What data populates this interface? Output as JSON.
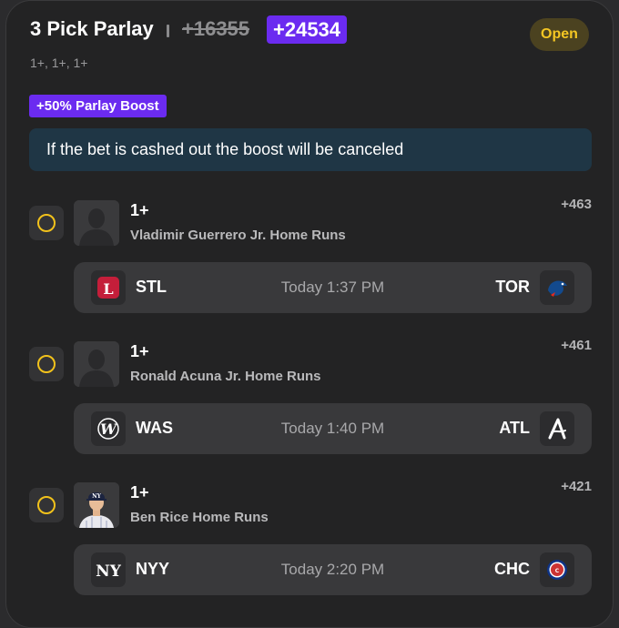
{
  "header": {
    "title": "3 Pick Parlay",
    "original_odds": "+16355",
    "boosted_odds": "+24534",
    "status": "Open",
    "subtitle": "1+, 1+, 1+"
  },
  "boost": {
    "badge": "+50% Parlay Boost",
    "notice": "If the bet is cashed out the boost will be canceled"
  },
  "legs": [
    {
      "line": "1+",
      "market": "Vladimir Guerrero Jr. Home Runs",
      "odds": "+463",
      "avatar": "player-silhouette-icon",
      "away_team": "STL",
      "home_team": "TOR",
      "time": "Today 1:37 PM",
      "away_logo": "cardinals-logo",
      "home_logo": "blue-jays-logo"
    },
    {
      "line": "1+",
      "market": "Ronald Acuna Jr. Home Runs",
      "odds": "+461",
      "avatar": "player-silhouette-icon",
      "away_team": "WAS",
      "home_team": "ATL",
      "time": "Today 1:40 PM",
      "away_logo": "nationals-logo",
      "home_logo": "braves-logo"
    },
    {
      "line": "1+",
      "market": "Ben Rice Home Runs",
      "odds": "+421",
      "avatar": "player-photo",
      "away_team": "NYY",
      "home_team": "CHC",
      "time": "Today 2:20 PM",
      "away_logo": "yankees-logo",
      "home_logo": "cubs-logo"
    }
  ],
  "colors": {
    "accent_purple": "#6b2bf0",
    "status_yellow": "#f4c623",
    "card_bg": "#232324",
    "notice_bg": "#1f3645"
  }
}
